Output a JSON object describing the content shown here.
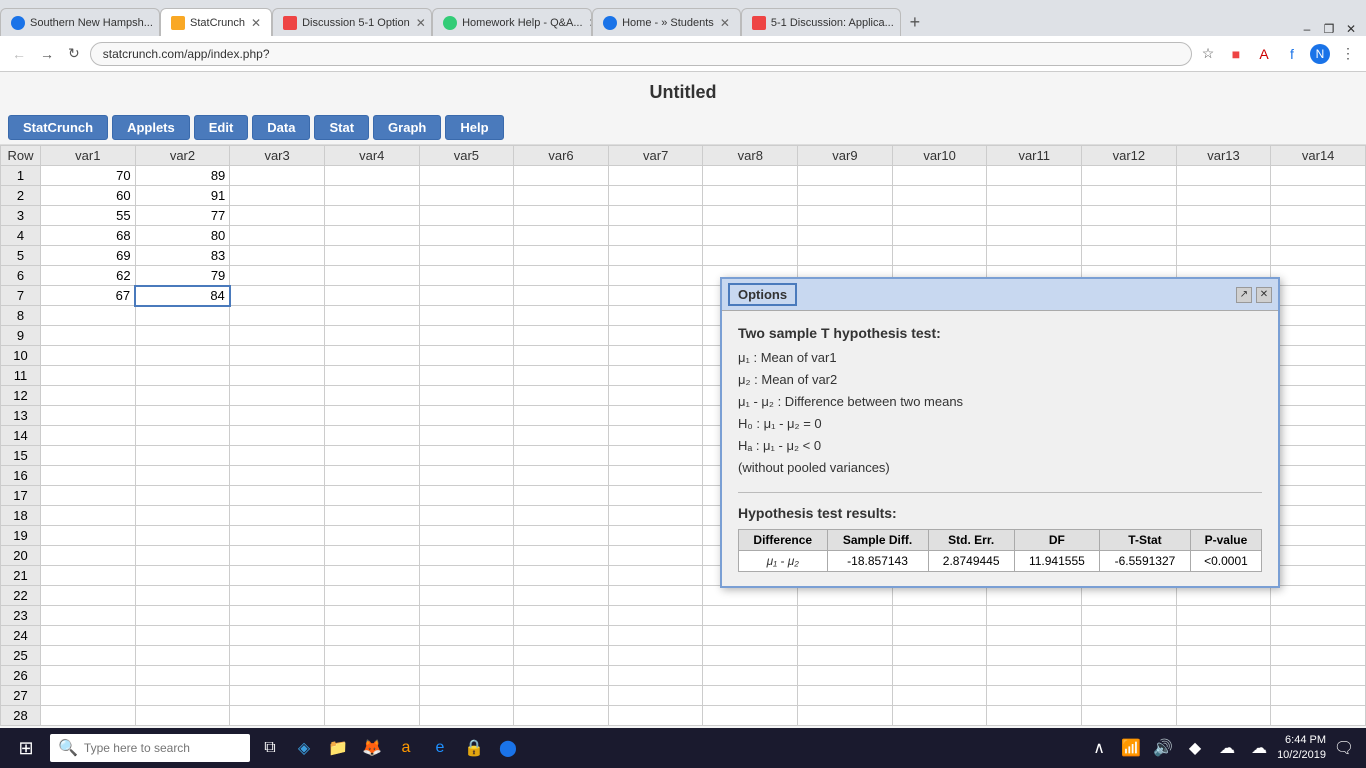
{
  "browser": {
    "tabs": [
      {
        "id": "tab1",
        "label": "Southern New Hampsh...",
        "active": false,
        "icon_color": "#1a73e8"
      },
      {
        "id": "tab2",
        "label": "StatCrunch",
        "active": true,
        "icon_color": "#f9a825"
      },
      {
        "id": "tab3",
        "label": "Discussion 5-1 Option",
        "active": false,
        "icon_color": "#e44"
      },
      {
        "id": "tab4",
        "label": "Homework Help - Q&A...",
        "active": false,
        "icon_color": "#3c7"
      },
      {
        "id": "tab5",
        "label": "Home - » Students",
        "active": false,
        "icon_color": "#1a73e8"
      },
      {
        "id": "tab6",
        "label": "5-1 Discussion: Applica...",
        "active": false,
        "icon_color": "#e44"
      }
    ],
    "address": "statcrunch.com/app/index.php?"
  },
  "app": {
    "title": "Untitled",
    "menu": {
      "buttons": [
        "StatCrunch",
        "Applets",
        "Edit",
        "Data",
        "Stat",
        "Graph",
        "Help"
      ]
    }
  },
  "spreadsheet": {
    "columns": [
      "Row",
      "var1",
      "var2",
      "var3",
      "var4",
      "var5",
      "var6",
      "var7",
      "var8",
      "var9",
      "var10",
      "var11",
      "var12",
      "var13",
      "var14"
    ],
    "rows": [
      {
        "row": 1,
        "var1": "70",
        "var2": "89"
      },
      {
        "row": 2,
        "var1": "60",
        "var2": "91"
      },
      {
        "row": 3,
        "var1": "55",
        "var2": "77"
      },
      {
        "row": 4,
        "var1": "68",
        "var2": "80"
      },
      {
        "row": 5,
        "var1": "69",
        "var2": "83"
      },
      {
        "row": 6,
        "var1": "62",
        "var2": "79"
      },
      {
        "row": 7,
        "var1": "67",
        "var2": "84"
      },
      {
        "row": 8,
        "var1": "",
        "var2": ""
      },
      {
        "row": 9,
        "var1": "",
        "var2": ""
      },
      {
        "row": 10,
        "var1": "",
        "var2": ""
      },
      {
        "row": 11,
        "var1": "",
        "var2": ""
      },
      {
        "row": 12,
        "var1": "",
        "var2": ""
      },
      {
        "row": 13,
        "var1": "",
        "var2": ""
      },
      {
        "row": 14,
        "var1": "",
        "var2": ""
      },
      {
        "row": 15,
        "var1": "",
        "var2": ""
      },
      {
        "row": 16,
        "var1": "",
        "var2": ""
      },
      {
        "row": 17,
        "var1": "",
        "var2": ""
      },
      {
        "row": 18,
        "var1": "",
        "var2": ""
      },
      {
        "row": 19,
        "var1": "",
        "var2": ""
      },
      {
        "row": 20,
        "var1": "",
        "var2": ""
      },
      {
        "row": 21,
        "var1": "",
        "var2": ""
      },
      {
        "row": 22,
        "var1": "",
        "var2": ""
      },
      {
        "row": 23,
        "var1": "",
        "var2": ""
      },
      {
        "row": 24,
        "var1": "",
        "var2": ""
      },
      {
        "row": 25,
        "var1": "",
        "var2": ""
      },
      {
        "row": 26,
        "var1": "",
        "var2": ""
      },
      {
        "row": 27,
        "var1": "",
        "var2": ""
      },
      {
        "row": 28,
        "var1": "",
        "var2": ""
      }
    ]
  },
  "dialog": {
    "title": "Options",
    "hypothesis_title": "Two sample T hypothesis test:",
    "mu1_label": "μ₁ : Mean of var1",
    "mu2_label": "μ₂ : Mean of var2",
    "diff_label": "μ₁ - μ₂ : Difference between two means",
    "h0_label": "H₀ : μ₁ - μ₂ = 0",
    "ha_label": "Hₐ : μ₁ - μ₂ < 0",
    "note": "(without pooled variances)",
    "results_title": "Hypothesis test results:",
    "table_headers": [
      "Difference",
      "Sample Diff.",
      "Std. Err.",
      "DF",
      "T-Stat",
      "P-value"
    ],
    "result_row": {
      "difference": "μ₁ - μ₂",
      "sample_diff": "-18.857143",
      "std_err": "2.8749445",
      "df": "11.941555",
      "t_stat": "-6.5591327",
      "p_value": "<0.0001"
    }
  },
  "taskbar": {
    "search_placeholder": "Type here to search",
    "time": "6:44 PM",
    "date": "10/2/2019"
  }
}
